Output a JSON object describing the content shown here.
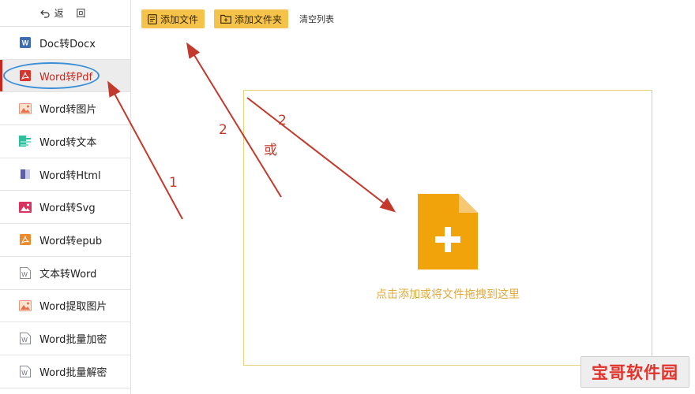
{
  "sidebar": {
    "back_label": "返 回",
    "items": [
      {
        "label": "Doc转Docx",
        "icon": "word-doc-icon"
      },
      {
        "label": "Word转Pdf",
        "icon": "pdf-icon",
        "active": true
      },
      {
        "label": "Word转图片",
        "icon": "image-icon"
      },
      {
        "label": "Word转文本",
        "icon": "text-doc-icon"
      },
      {
        "label": "Word转Html",
        "icon": "html-book-icon"
      },
      {
        "label": "Word转Svg",
        "icon": "svg-image-icon"
      },
      {
        "label": "Word转epub",
        "icon": "epub-icon"
      },
      {
        "label": "文本转Word",
        "icon": "word-outline-icon"
      },
      {
        "label": "Word提取图片",
        "icon": "extract-image-icon"
      },
      {
        "label": "Word批量加密",
        "icon": "word-outline-icon"
      },
      {
        "label": "Word批量解密",
        "icon": "word-outline-icon"
      }
    ]
  },
  "toolbar": {
    "add_file": "添加文件",
    "add_folder": "添加文件夹",
    "clear_list": "清空列表"
  },
  "dropzone": {
    "hint": "点击添加或将文件拖拽到这里"
  },
  "annotations": {
    "step1": "1",
    "step2a": "2",
    "step2b": "2",
    "or": "或"
  },
  "watermark": "宝哥软件园",
  "colors": {
    "accent_yellow": "#f6c34a",
    "icon_orange": "#f0a30a",
    "annotation_red": "#c33a2c",
    "highlight_blue": "#3b8fd6"
  }
}
